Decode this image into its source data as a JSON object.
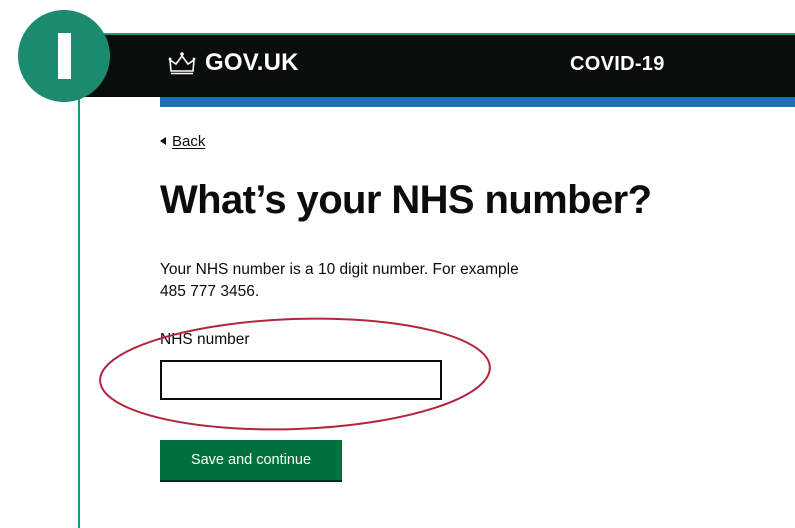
{
  "header": {
    "brand": "GOV.UK",
    "service_name": "COVID-19"
  },
  "step": {
    "indicator": "I"
  },
  "main": {
    "back_label": "Back",
    "title": "What’s your NHS number?",
    "hint_line1": "Your NHS number is a 10 digit number. For example",
    "hint_line2": "485 777 3456.",
    "field_label": "NHS number",
    "field_value": "",
    "save_label": "Save and continue"
  },
  "colors": {
    "header_bg": "#0b0c0c",
    "header_accent": "#1d70b8",
    "badge": "#1b8a6f",
    "highlight": "#b3243f",
    "button": "#00703c"
  }
}
